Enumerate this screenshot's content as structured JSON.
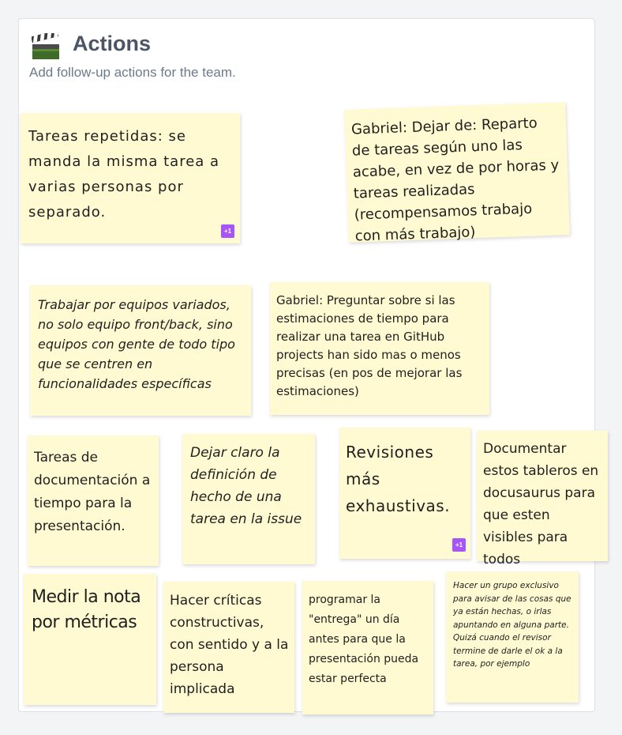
{
  "board": {
    "title": "Actions",
    "subtitle": "Add follow-up actions for the team.",
    "icon": "clapperboard-icon"
  },
  "colors": {
    "note": "#fffad1",
    "vote_badge": "#a855f7",
    "title": "#4b5563",
    "subtitle": "#6b7b8c"
  },
  "notes": [
    {
      "text": "Tareas repetidas: se manda la misma tarea a varias personas por separado.",
      "votes": "+1"
    },
    {
      "text": "Gabriel: Dejar de: Reparto de tareas según uno las acabe, en vez de por horas y tareas realizadas (recompensamos trabajo con más trabajo)"
    },
    {
      "text": "Trabajar por equipos variados, no solo equipo front/back, sino equipos con gente de todo tipo que se centren en funcionalidades específicas"
    },
    {
      "text": "Gabriel: Preguntar sobre si las estimaciones de tiempo para realizar una tarea en GitHub projects han sido mas o menos precisas (en pos de mejorar las estimaciones)"
    },
    {
      "text": "Tareas de documentación a tiempo para la presentación."
    },
    {
      "text": "Dejar claro la definición de hecho de una tarea en la issue"
    },
    {
      "text": "Revisiones más exhaustivas.",
      "votes": "+1"
    },
    {
      "text": "Documentar estos tableros en docusaurus para que esten visibles para todos"
    },
    {
      "text": "Medir la nota por métricas"
    },
    {
      "text": "Hacer críticas constructivas, con sentido y a la persona implicada"
    },
    {
      "text": "programar la \"entrega\" un día antes para que la presentación pueda estar perfecta"
    },
    {
      "text": "Hacer un grupo exclusivo para avisar de las cosas que ya están hechas, o irlas apuntando en alguna parte. Quizá cuando el revisor termine de darle el ok a la tarea, por ejemplo"
    }
  ]
}
